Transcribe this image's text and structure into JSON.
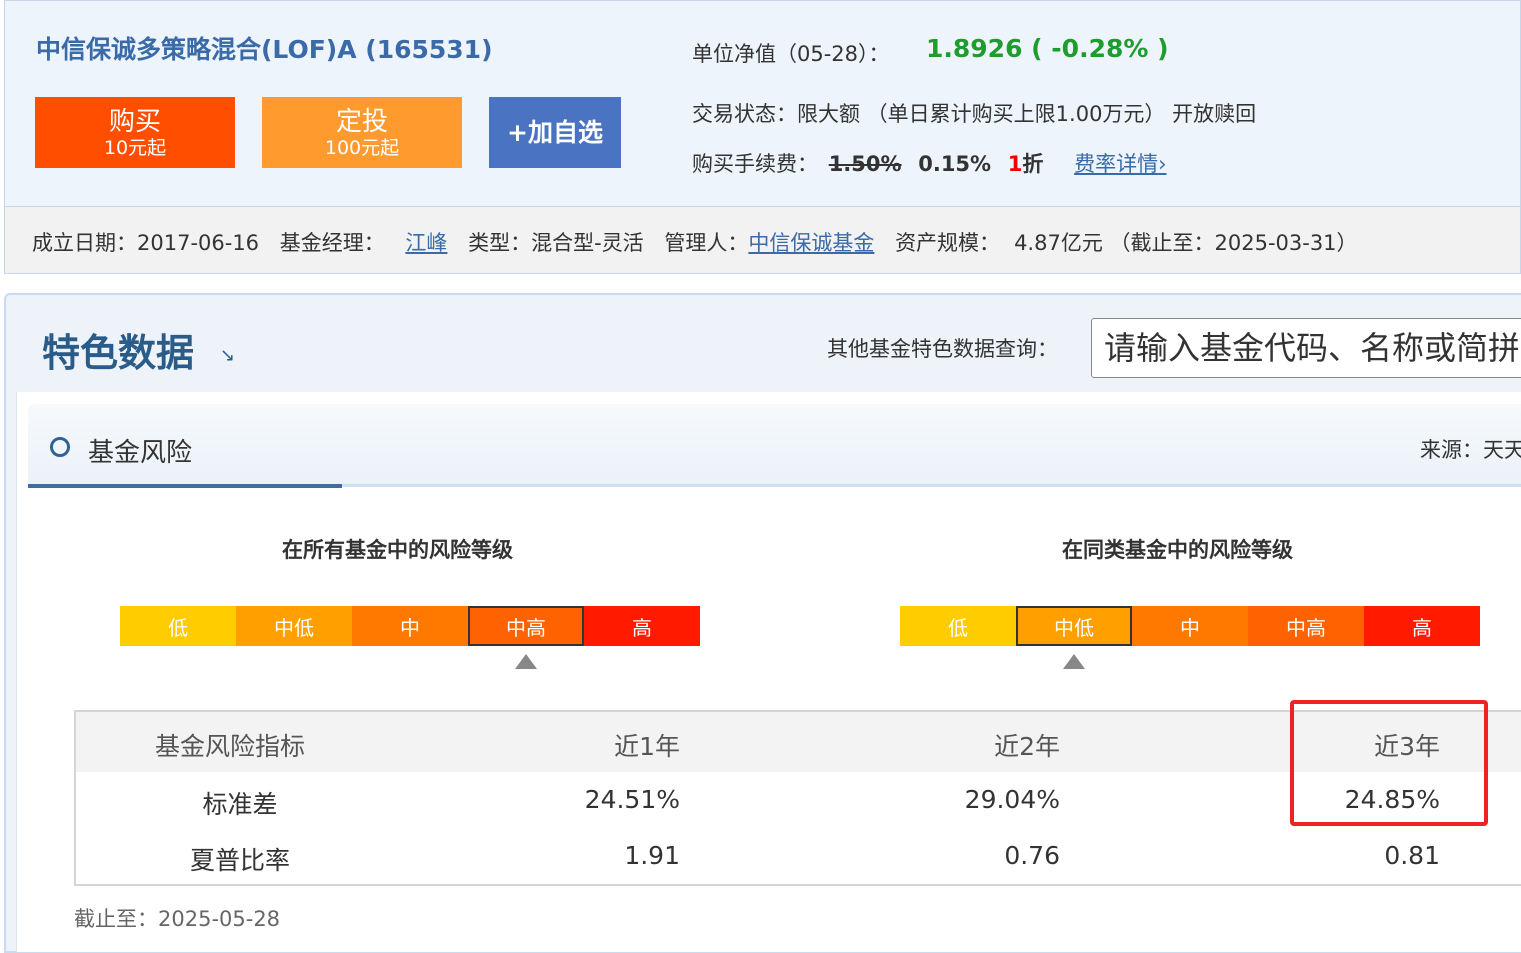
{
  "fund": {
    "title": "中信保诚多策略混合(LOF)A (165531)",
    "nav_label": "单位净值（05-28）：",
    "nav_value": "1.8926 ( -0.28% )",
    "trade_status_label": "交易状态：",
    "trade_status_value": "限大额 （单日累计购买上限1.00万元） 开放赎回",
    "fee_label": "购买手续费：",
    "fee_original": "1.50%",
    "fee_current": "0.15%",
    "fee_discount_num": "1",
    "fee_discount_unit": "折",
    "fee_link": "费率详情",
    "fee_link_arrow": "›"
  },
  "buttons": {
    "buy_main": "购买",
    "buy_sub": "10元起",
    "invest_main": "定投",
    "invest_sub": "100元起",
    "watch_label": "+加自选"
  },
  "info": {
    "established_label": "成立日期：",
    "established_value": "2017-06-16",
    "manager_label": "基金经理：",
    "manager_value": "江峰",
    "type_label": "类型：",
    "type_value": "混合型-灵活",
    "company_label": "管理人：",
    "company_value": "中信保诚基金",
    "scale_label": "资产规模：",
    "scale_value": "4.87亿元 （截止至：2025-03-31）"
  },
  "feature": {
    "title": "特色数据",
    "arrow": "↘",
    "search_label": "其他基金特色数据查询：",
    "search_placeholder": "请输入基金代码、名称或简拼"
  },
  "risk": {
    "title": "基金风险",
    "source": "来源：天天基金",
    "all_title": "在所有基金中的风险等级",
    "peer_title": "在同类基金中的风险等级",
    "levels": [
      "低",
      "中低",
      "中",
      "中高",
      "高"
    ],
    "level_colors": [
      "#ffcc00",
      "#ff9f00",
      "#ff7800",
      "#ff6200",
      "#ff1a00"
    ],
    "all_selected": "中高",
    "peer_selected": "中低",
    "table": {
      "headers": [
        "基金风险指标",
        "近1年",
        "近2年",
        "近3年"
      ],
      "rows": [
        [
          "标准差",
          "24.51%",
          "29.04%",
          "24.85%"
        ],
        [
          "夏普比率",
          "1.91",
          "0.76",
          "0.81"
        ]
      ]
    },
    "as_of": "截止至：2025-05-28"
  }
}
